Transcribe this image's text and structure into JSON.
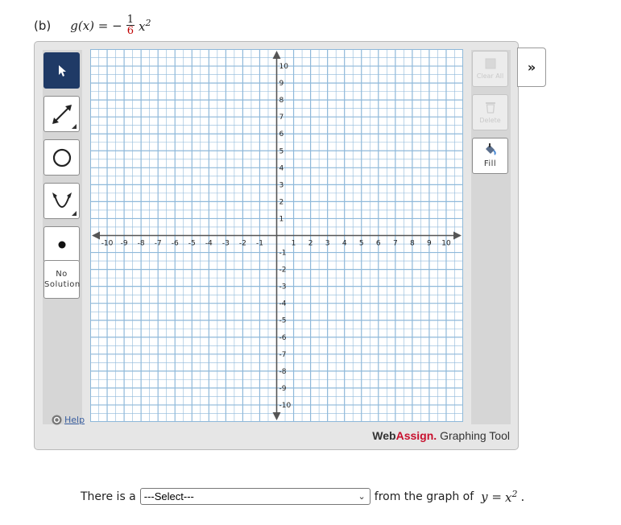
{
  "problem": {
    "part": "(b)",
    "lhs": "g(x) = −",
    "frac_num": "1",
    "frac_den": "6",
    "var": "x",
    "exp": "2"
  },
  "toolbar": {
    "no_solution_line1": "No",
    "no_solution_line2": "Solution",
    "help_label": "Help"
  },
  "right_toolbar": {
    "clear_all_label": "Clear All",
    "delete_label": "Delete",
    "fill_label": "Fill"
  },
  "expand_label": "»",
  "brand": {
    "web": "Web",
    "assign": "Assign.",
    "tool": " Graphing Tool"
  },
  "graph": {
    "xmin": -11,
    "xmax": 11,
    "ymin": -11,
    "ymax": 11,
    "label_min": -10,
    "label_max": 10
  },
  "answer": {
    "prefix": "There is a",
    "select_value": "---Select---",
    "suffix": "from the graph of",
    "eq_lhs": "y = ",
    "eq_var": "x",
    "eq_exp": "2",
    "period": "."
  },
  "colors": {
    "grid_line": "#8fb9da",
    "axis": "#555555",
    "active_tool": "#1f3a66",
    "brand_accent": "#c8102e",
    "fraction_denominator": "#c00000"
  }
}
